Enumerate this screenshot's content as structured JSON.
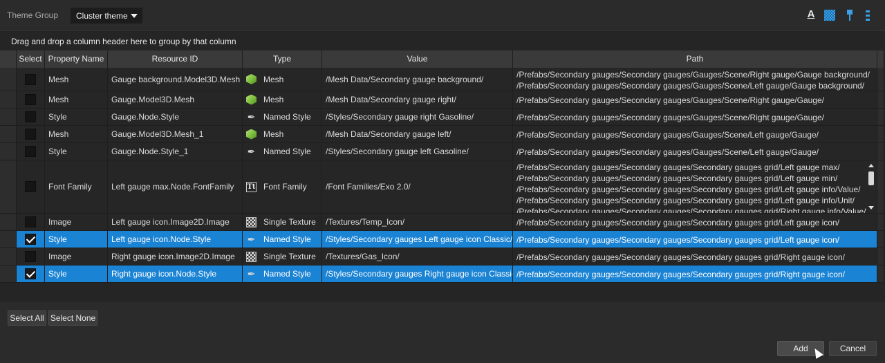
{
  "theme_group": {
    "label": "Theme Group",
    "selected": "Cluster theme"
  },
  "toolbar": {
    "icons": [
      "text-format-icon",
      "checker-icon",
      "brush-icon",
      "list-icon"
    ],
    "text_icon_glyph": "A"
  },
  "group_hint": "Drag and drop a column header here to group by that column",
  "columns": [
    "Select",
    "Property Name",
    "Resource ID",
    "Type",
    "Value",
    "Path"
  ],
  "rows": [
    {
      "checked": false,
      "selected": false,
      "property": "Mesh",
      "resource_id": "Gauge background.Model3D.Mesh",
      "type": "Mesh",
      "icon": "mesh",
      "value": "/Mesh Data/Secondary gauge background/",
      "path": [
        "/Prefabs/Secondary gauges/Secondary gauges/Gauges/Scene/Right gauge/Gauge background/",
        "/Prefabs/Secondary gauges/Secondary gauges/Gauges/Scene/Left gauge/Gauge background/"
      ]
    },
    {
      "checked": false,
      "selected": false,
      "property": "Mesh",
      "resource_id": "Gauge.Model3D.Mesh",
      "type": "Mesh",
      "icon": "mesh",
      "value": "/Mesh Data/Secondary gauge right/",
      "path": [
        "/Prefabs/Secondary gauges/Secondary gauges/Gauges/Scene/Right gauge/Gauge/"
      ]
    },
    {
      "checked": false,
      "selected": false,
      "property": "Style",
      "resource_id": "Gauge.Node.Style",
      "type": "Named Style",
      "icon": "style",
      "value": "/Styles/Secondary gauge right Gasoline/",
      "path": [
        "/Prefabs/Secondary gauges/Secondary gauges/Gauges/Scene/Right gauge/Gauge/"
      ]
    },
    {
      "checked": false,
      "selected": false,
      "property": "Mesh",
      "resource_id": "Gauge.Model3D.Mesh_1",
      "type": "Mesh",
      "icon": "mesh",
      "value": "/Mesh Data/Secondary gauge left/",
      "path": [
        "/Prefabs/Secondary gauges/Secondary gauges/Gauges/Scene/Left gauge/Gauge/"
      ]
    },
    {
      "checked": false,
      "selected": false,
      "property": "Style",
      "resource_id": "Gauge.Node.Style_1",
      "type": "Named Style",
      "icon": "style",
      "value": "/Styles/Secondary gauge left Gasoline/",
      "path": [
        "/Prefabs/Secondary gauges/Secondary gauges/Gauges/Scene/Left gauge/Gauge/"
      ]
    },
    {
      "checked": false,
      "selected": false,
      "property": "Font Family",
      "resource_id": "Left gauge max.Node.FontFamily",
      "type": "Font Family",
      "icon": "font",
      "value": "/Font Families/Exo 2.0/",
      "path": [
        "/Prefabs/Secondary gauges/Secondary gauges/Secondary gauges grid/Left gauge max/",
        "/Prefabs/Secondary gauges/Secondary gauges/Secondary gauges grid/Left gauge min/",
        "/Prefabs/Secondary gauges/Secondary gauges/Secondary gauges grid/Left gauge info/Value/",
        "/Prefabs/Secondary gauges/Secondary gauges/Secondary gauges grid/Left gauge info/Unit/",
        "/Prefabs/Secondary gauges/Secondary gauges/Secondary gauges grid/Right gauge info/Value/"
      ]
    },
    {
      "checked": false,
      "selected": false,
      "property": "Image",
      "resource_id": "Left gauge icon.Image2D.Image",
      "type": "Single Texture",
      "icon": "tex",
      "value": "/Textures/Temp_Icon/",
      "path": [
        "/Prefabs/Secondary gauges/Secondary gauges/Secondary gauges grid/Left gauge icon/"
      ]
    },
    {
      "checked": true,
      "selected": true,
      "property": "Style",
      "resource_id": "Left gauge icon.Node.Style",
      "type": "Named Style",
      "icon": "style",
      "value": "/Styles/Secondary gauges Left gauge icon Classic/",
      "path": [
        "/Prefabs/Secondary gauges/Secondary gauges/Secondary gauges grid/Left gauge icon/"
      ]
    },
    {
      "checked": false,
      "selected": false,
      "property": "Image",
      "resource_id": "Right gauge icon.Image2D.Image",
      "type": "Single Texture",
      "icon": "tex",
      "value": "/Textures/Gas_Icon/",
      "path": [
        "/Prefabs/Secondary gauges/Secondary gauges/Secondary gauges grid/Right gauge icon/"
      ]
    },
    {
      "checked": true,
      "selected": true,
      "property": "Style",
      "resource_id": "Right gauge icon.Node.Style",
      "type": "Named Style",
      "icon": "style",
      "value": "/Styles/Secondary gauges Right gauge icon Classic/",
      "path": [
        "/Prefabs/Secondary gauges/Secondary gauges/Secondary gauges grid/Right gauge icon/"
      ]
    }
  ],
  "buttons": {
    "select_all": "Select All",
    "select_none": "Select None",
    "add": "Add",
    "cancel": "Cancel"
  },
  "colors": {
    "selection": "#1b83d4",
    "background": "#2b2b2b"
  }
}
